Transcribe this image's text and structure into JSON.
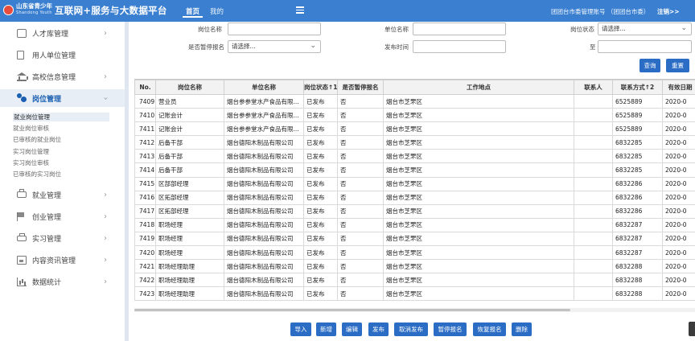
{
  "header": {
    "logo_cn": "山东省青少年",
    "logo_en": "Shandong Youth",
    "title": "互联网+服务与大数据平台",
    "nav": [
      "首页",
      "我的"
    ],
    "user": "团团台市委管理账号 （团团台市委）",
    "logout": "注销>>",
    "menu_icon": "hamburger-icon"
  },
  "sidebar": {
    "items": [
      {
        "label": "人才库管理",
        "icon": "person-card-icon"
      },
      {
        "label": "用人单位管理",
        "icon": "document-icon"
      },
      {
        "label": "高校信息管理",
        "icon": "bank-icon"
      },
      {
        "label": "岗位管理",
        "icon": "users-icon"
      },
      {
        "label": "就业管理",
        "icon": "briefcase-icon"
      },
      {
        "label": "创业管理",
        "icon": "flag-icon"
      },
      {
        "label": "实习管理",
        "icon": "printer-icon"
      },
      {
        "label": "内容资讯管理",
        "icon": "image-icon"
      },
      {
        "label": "数据统计",
        "icon": "bar-chart-icon"
      }
    ],
    "sub_items": [
      "就业岗位管理",
      "就业岗位审核",
      "已审核的就业岗位",
      "实习岗位管理",
      "实习岗位审核",
      "已审核的实习岗位"
    ]
  },
  "search": {
    "position_name_label": "岗位名称",
    "unit_name_label": "单位名称",
    "position_status_label": "岗位状态",
    "position_status_value": "请选择...",
    "pause_label": "是否暂停报名",
    "pause_value": "请选择...",
    "publish_time_label": "发布时间",
    "to_label": "至",
    "query_button": "查询",
    "reset_button": "重置"
  },
  "table": {
    "columns": [
      "No.",
      "岗位名称",
      "单位名称",
      "岗位状态↑1",
      "是否暂停报名",
      "工作地点",
      "联系人",
      "联系方式↑2",
      "有效日期"
    ],
    "rows": [
      [
        "7409",
        "营业员",
        "烟台参参堂水产食品有限...",
        "已发布",
        "否",
        "烟台市芝罘区",
        "",
        "6525889",
        "2020-0"
      ],
      [
        "7410",
        "记账会计",
        "烟台参参堂水产食品有限...",
        "已发布",
        "否",
        "烟台市芝罘区",
        "",
        "6525889",
        "2020-0"
      ],
      [
        "7411",
        "记账会计",
        "烟台参参堂水产食品有限...",
        "已发布",
        "否",
        "烟台市芝罘区",
        "",
        "6525889",
        "2020-0"
      ],
      [
        "7412",
        "后备干部",
        "烟台德阳木制品有限公司",
        "已发布",
        "否",
        "烟台市芝罘区",
        "",
        "6832285",
        "2020-0"
      ],
      [
        "7413",
        "后备干部",
        "烟台德阳木制品有限公司",
        "已发布",
        "否",
        "烟台市芝罘区",
        "",
        "6832285",
        "2020-0"
      ],
      [
        "7414",
        "后备干部",
        "烟台德阳木制品有限公司",
        "已发布",
        "否",
        "烟台市芝罘区",
        "",
        "6832285",
        "2020-0"
      ],
      [
        "7415",
        "区部部经理",
        "烟台德阳木制品有限公司",
        "已发布",
        "否",
        "烟台市芝罘区",
        "",
        "6832286",
        "2020-0"
      ],
      [
        "7416",
        "区拓部经理",
        "烟台德阳木制品有限公司",
        "已发布",
        "否",
        "烟台市芝罘区",
        "",
        "6832286",
        "2020-0"
      ],
      [
        "7417",
        "区拓部经理",
        "烟台德阳木制品有限公司",
        "已发布",
        "否",
        "烟台市芝罘区",
        "",
        "6832286",
        "2020-0"
      ],
      [
        "7418",
        "职场经理",
        "烟台德阳木制品有限公司",
        "已发布",
        "否",
        "烟台市芝罘区",
        "",
        "6832287",
        "2020-0"
      ],
      [
        "7419",
        "职场经理",
        "烟台德阳木制品有限公司",
        "已发布",
        "否",
        "烟台市芝罘区",
        "",
        "6832287",
        "2020-0"
      ],
      [
        "7420",
        "职场经理",
        "烟台德阳木制品有限公司",
        "已发布",
        "否",
        "烟台市芝罘区",
        "",
        "6832287",
        "2020-0"
      ],
      [
        "7421",
        "职场经理助理",
        "烟台德阳木制品有限公司",
        "已发布",
        "否",
        "烟台市芝罘区",
        "",
        "6832288",
        "2020-0"
      ],
      [
        "7422",
        "职场经理助理",
        "烟台德阳木制品有限公司",
        "已发布",
        "否",
        "烟台市芝罘区",
        "",
        "6832288",
        "2020-0"
      ],
      [
        "7423",
        "职场经理助理",
        "烟台德阳木制品有限公司",
        "已发布",
        "否",
        "烟台市芝罘区",
        "",
        "6832288",
        "2020-0"
      ]
    ]
  },
  "actions": [
    "导入",
    "新增",
    "编辑",
    "发布",
    "取消发布",
    "暂停报名",
    "恢复报名",
    "删除"
  ],
  "colors": {
    "brand": "#3a7fd0",
    "button": "#2b6cc4"
  }
}
